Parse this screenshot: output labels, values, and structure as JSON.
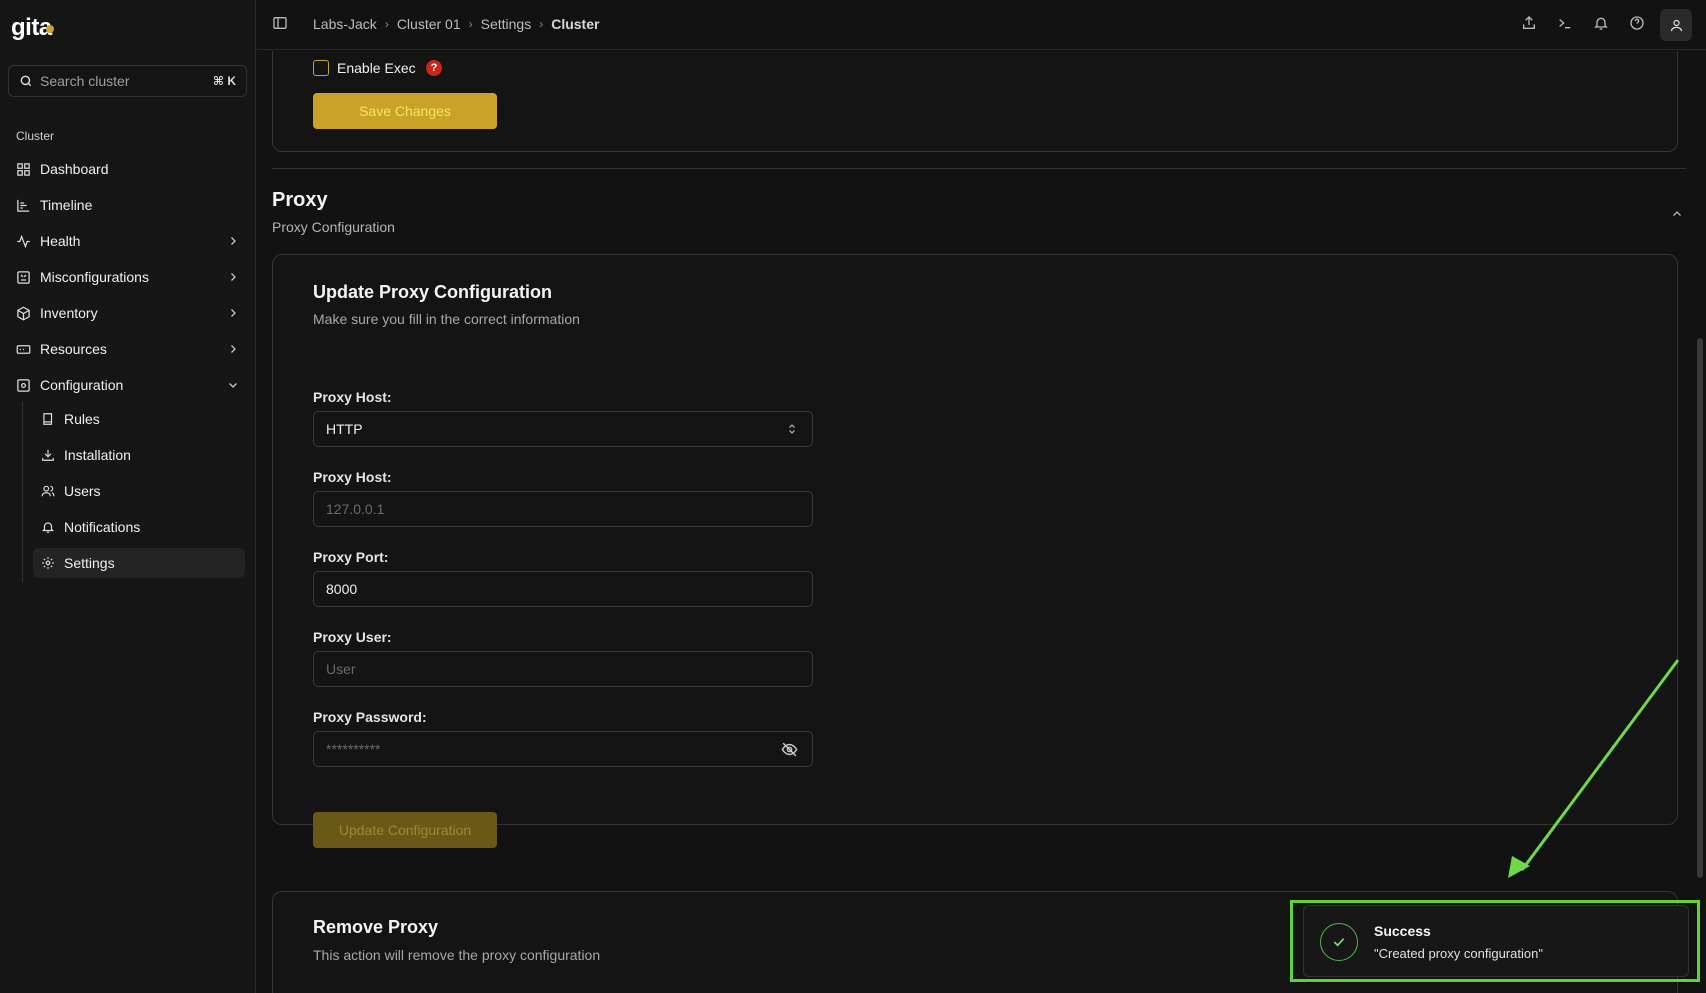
{
  "app": {
    "logo": "gita"
  },
  "sidebar": {
    "search_placeholder": "Search cluster",
    "search_shortcut": "⌘ K",
    "section_label": "Cluster",
    "items": [
      {
        "label": "Dashboard",
        "icon": "grid-icon"
      },
      {
        "label": "Timeline",
        "icon": "timeline-icon"
      },
      {
        "label": "Health",
        "icon": "activity-icon"
      },
      {
        "label": "Misconfigurations",
        "icon": "misconfig-icon"
      },
      {
        "label": "Inventory",
        "icon": "box-icon"
      },
      {
        "label": "Resources",
        "icon": "resources-icon"
      },
      {
        "label": "Configuration",
        "icon": "config-icon"
      }
    ],
    "sub_items": [
      {
        "label": "Rules",
        "icon": "book-icon"
      },
      {
        "label": "Installation",
        "icon": "install-icon"
      },
      {
        "label": "Users",
        "icon": "users-icon"
      },
      {
        "label": "Notifications",
        "icon": "bell-icon"
      },
      {
        "label": "Settings",
        "icon": "gear-icon"
      }
    ]
  },
  "breadcrumb": [
    "Labs-Jack",
    "Cluster 01",
    "Settings",
    "Cluster"
  ],
  "exec": {
    "checkbox_label": "Enable Exec",
    "help": "?",
    "save_label": "Save Changes"
  },
  "proxy": {
    "heading": "Proxy",
    "subheading": "Proxy Configuration",
    "update_card": {
      "title": "Update Proxy Configuration",
      "desc": "Make sure you fill in the correct information",
      "type_label": "Proxy Host:",
      "type_value": "HTTP",
      "host_label": "Proxy Host:",
      "host_placeholder": "127.0.0.1",
      "port_label": "Proxy Port:",
      "port_value": "8000",
      "user_label": "Proxy User:",
      "user_placeholder": "User",
      "password_label": "Proxy Password:",
      "password_placeholder": "**********",
      "button_label": "Update Configuration"
    },
    "remove_card": {
      "title": "Remove Proxy",
      "desc": "This action will remove the proxy configuration"
    }
  },
  "toast": {
    "title": "Success",
    "message": "\"Created proxy configuration\""
  },
  "colors": {
    "accent": "#c9a227",
    "success": "#5ed33a",
    "danger": "#c8261b"
  }
}
